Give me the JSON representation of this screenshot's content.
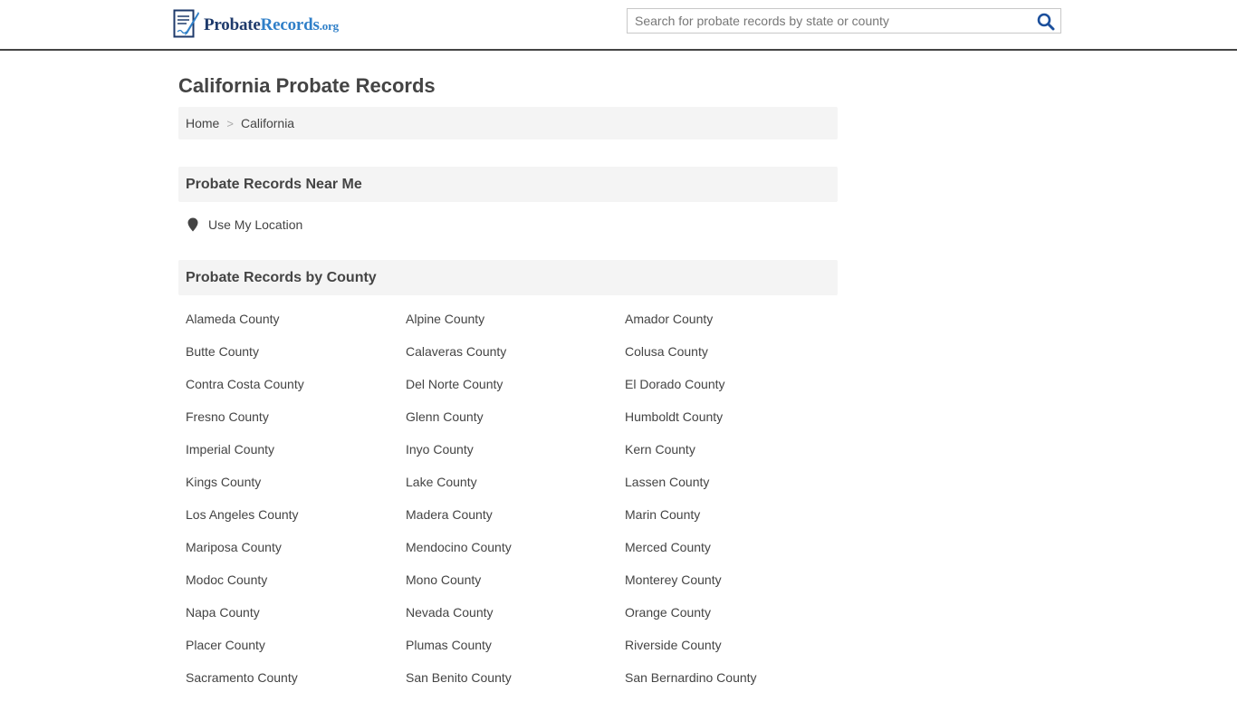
{
  "header": {
    "logo_main": "Probate",
    "logo_accent": "Records",
    "logo_tld": ".org",
    "search_placeholder": "Search for probate records by state or county",
    "search_icon": "search-icon"
  },
  "page": {
    "title": "California Probate Records",
    "breadcrumb": [
      {
        "label": "Home"
      },
      {
        "label": "California"
      }
    ],
    "breadcrumb_sep": ">"
  },
  "near_me": {
    "heading": "Probate Records Near Me",
    "location_label": "Use My Location",
    "location_icon": "map-pin-icon"
  },
  "by_county": {
    "heading": "Probate Records by County",
    "counties": [
      "Alameda County",
      "Alpine County",
      "Amador County",
      "Butte County",
      "Calaveras County",
      "Colusa County",
      "Contra Costa County",
      "Del Norte County",
      "El Dorado County",
      "Fresno County",
      "Glenn County",
      "Humboldt County",
      "Imperial County",
      "Inyo County",
      "Kern County",
      "Kings County",
      "Lake County",
      "Lassen County",
      "Los Angeles County",
      "Madera County",
      "Marin County",
      "Mariposa County",
      "Mendocino County",
      "Merced County",
      "Modoc County",
      "Mono County",
      "Monterey County",
      "Napa County",
      "Nevada County",
      "Orange County",
      "Placer County",
      "Plumas County",
      "Riverside County",
      "Sacramento County",
      "San Benito County",
      "San Bernardino County"
    ]
  },
  "colors": {
    "text": "#444444",
    "panel": "#f4f4f4",
    "logo_dark": "#1e3a6b",
    "logo_blue": "#2f7fc8",
    "search_icon": "#1b4f9c"
  }
}
